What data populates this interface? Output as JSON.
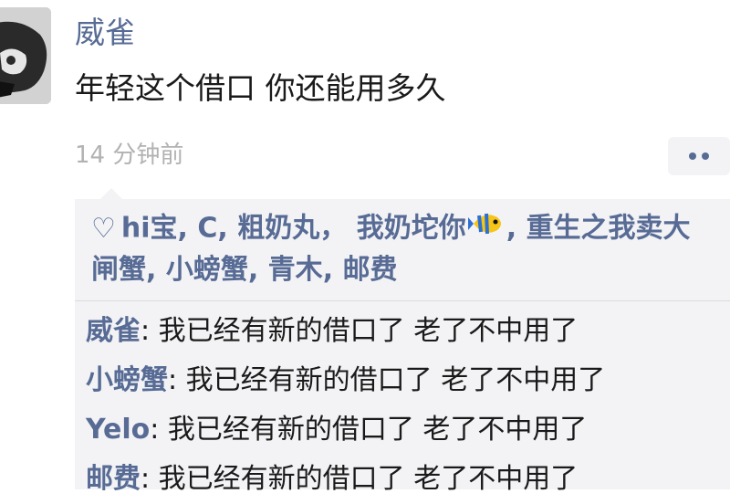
{
  "post": {
    "author": "威雀",
    "text": "年轻这个借口 你还能用多久",
    "time": "14 分钟前"
  },
  "likes": {
    "names_before_emoji": [
      "hi宝",
      "C",
      "粗奶丸",
      "我奶坨你"
    ],
    "separators": [
      ", ",
      ", ",
      "， "
    ],
    "emoji": "tropical-fish-emoji",
    "names_after_emoji": [
      "重生之我卖大闸蟹",
      "小螃蟹",
      "青木",
      "邮费"
    ]
  },
  "comments": [
    {
      "author": "威雀",
      "text": "我已经有新的借口了 老了不中用了"
    },
    {
      "author": "小螃蟹",
      "text": "我已经有新的借口了 老了不中用了"
    },
    {
      "author": "Yelo",
      "text": "我已经有新的借口了 老了不中用了"
    },
    {
      "author": "邮费",
      "text": "我已经有新的借口了 老了不中用了"
    }
  ],
  "colors": {
    "link": "#576b95",
    "time": "#b2b2b2",
    "panel": "#f3f3f5"
  }
}
